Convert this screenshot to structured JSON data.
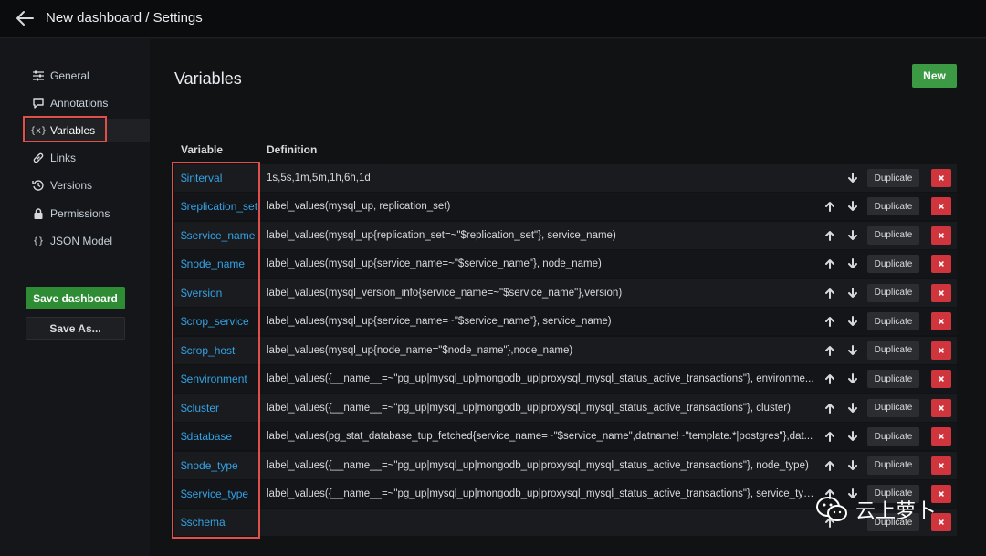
{
  "header": {
    "title": "New dashboard / Settings"
  },
  "sidebar": {
    "items": [
      {
        "label": "General",
        "icon": "sliders-icon"
      },
      {
        "label": "Annotations",
        "icon": "comment-icon"
      },
      {
        "label": "Variables",
        "icon": "variable-icon",
        "icon_glyph": "{x}"
      },
      {
        "label": "Links",
        "icon": "link-icon"
      },
      {
        "label": "Versions",
        "icon": "history-icon"
      },
      {
        "label": "Permissions",
        "icon": "lock-icon"
      },
      {
        "label": "JSON Model",
        "icon": "json-icon",
        "icon_glyph": "{}"
      }
    ],
    "save_label": "Save dashboard",
    "save_as_label": "Save As..."
  },
  "main": {
    "title": "Variables",
    "new_label": "New",
    "col_variable": "Variable",
    "col_definition": "Definition",
    "duplicate_label": "Duplicate",
    "rows": [
      {
        "name": "$interval",
        "definition": "1s,5s,1m,5m,1h,6h,1d"
      },
      {
        "name": "$replication_set",
        "definition": "label_values(mysql_up, replication_set)"
      },
      {
        "name": "$service_name",
        "definition": "label_values(mysql_up{replication_set=~\"$replication_set\"}, service_name)"
      },
      {
        "name": "$node_name",
        "definition": "label_values(mysql_up{service_name=~\"$service_name\"}, node_name)"
      },
      {
        "name": "$version",
        "definition": "label_values(mysql_version_info{service_name=~\"$service_name\"},version)"
      },
      {
        "name": "$crop_service",
        "definition": "label_values(mysql_up{service_name=~\"$service_name\"}, service_name)"
      },
      {
        "name": "$crop_host",
        "definition": "label_values(mysql_up{node_name=\"$node_name\"},node_name)"
      },
      {
        "name": "$environment",
        "definition": "label_values({__name__=~\"pg_up|mysql_up|mongodb_up|proxysql_mysql_status_active_transactions\"}, environme..."
      },
      {
        "name": "$cluster",
        "definition": "label_values({__name__=~\"pg_up|mysql_up|mongodb_up|proxysql_mysql_status_active_transactions\"}, cluster)"
      },
      {
        "name": "$database",
        "definition": "label_values(pg_stat_database_tup_fetched{service_name=~\"$service_name\",datname!~\"template.*|postgres\"},dat..."
      },
      {
        "name": "$node_type",
        "definition": "label_values({__name__=~\"pg_up|mysql_up|mongodb_up|proxysql_mysql_status_active_transactions\"}, node_type)"
      },
      {
        "name": "$service_type",
        "definition": "label_values({__name__=~\"pg_up|mysql_up|mongodb_up|proxysql_mysql_status_active_transactions\"}, service_typ..."
      },
      {
        "name": "$schema",
        "definition": ""
      }
    ]
  },
  "watermark": {
    "text": "云上萝卜"
  },
  "colors": {
    "accent_green": "#3c9a45",
    "link_blue": "#33a2e5",
    "delete_red": "#d0353d",
    "highlight_red": "#e0504a"
  }
}
